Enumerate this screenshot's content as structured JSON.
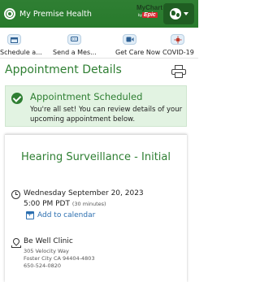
{
  "app": {
    "title": "My Premise Health",
    "logo_text_top": "MyChart",
    "logo_text_by": "by",
    "logo_text_brand": "Epic"
  },
  "quick_actions": [
    {
      "label": "Schedule a...",
      "icon": "calendar-icon"
    },
    {
      "label": "Send a Mes...",
      "icon": "message-icon"
    },
    {
      "label": "Get Care Now",
      "icon": "video-icon"
    },
    {
      "label": "COVID-19",
      "icon": "virus-icon"
    }
  ],
  "page": {
    "title": "Appointment Details",
    "print_icon": "printer-icon"
  },
  "banner": {
    "title": "Appointment Scheduled",
    "message": "You're all set! You can review details of your upcoming appointment below."
  },
  "appointment": {
    "title": "Hearing Surveillance - Initial",
    "date": "Wednesday September 20, 2023",
    "time": "5:00 PM PDT",
    "duration": "(30 minutes)",
    "add_to_calendar": "Add to calendar",
    "location_name": "Be Well Clinic",
    "address_line1": "305 Velocity Way",
    "address_line2": "Foster City CA 94404-4803",
    "phone": "650-524-0820"
  },
  "colors": {
    "brand_green": "#2f7f33",
    "banner_bg": "#e2f3e2",
    "link_blue": "#2c6fb0"
  }
}
